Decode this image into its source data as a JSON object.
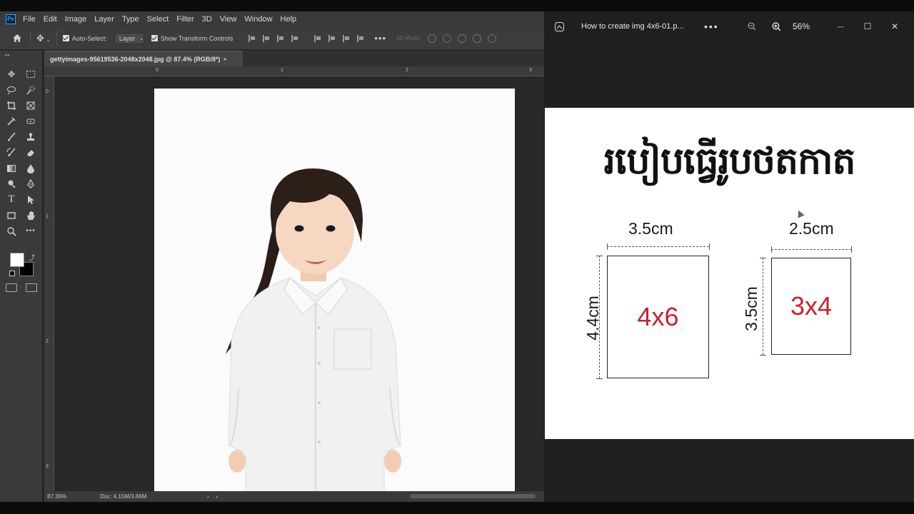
{
  "photoshop": {
    "logo": "Ps",
    "menu": [
      "File",
      "Edit",
      "Image",
      "Layer",
      "Type",
      "Select",
      "Filter",
      "3D",
      "View",
      "Window",
      "Help"
    ],
    "options": {
      "auto_select_label": "Auto-Select:",
      "auto_select_value": "Layer",
      "show_transform_label": "Show Transform Controls",
      "mode_3d_label": "3D Mode:",
      "more": "•••"
    },
    "document_tab": "gettyimages-95619536-2048x2048.jpg @ 87.4% (RGB/8*)",
    "ruler_top": [
      "0",
      "1",
      "2",
      "3"
    ],
    "ruler_left": [
      "0",
      "1",
      "2",
      "3"
    ],
    "status": {
      "zoom": "87.36%",
      "doc": "Doc: 4.15M/3.66M",
      "arrow": "›"
    }
  },
  "viewer": {
    "filename": "How to create img 4x6-01.p...",
    "more": "•••",
    "zoom": "56%",
    "window_buttons": [
      "—",
      "☐",
      "✕"
    ],
    "image": {
      "title": "របៀបធ្វើរូបថតកាត",
      "photo_a": {
        "width_label": "3.5cm",
        "height_label": "4.4cm",
        "size_label": "4x6"
      },
      "photo_b": {
        "width_label": "2.5cm",
        "height_label": "3.5cm",
        "size_label": "3x4"
      }
    }
  },
  "colors": {
    "accent_red": "#c8232c",
    "ps_blue": "#31a8ff"
  }
}
